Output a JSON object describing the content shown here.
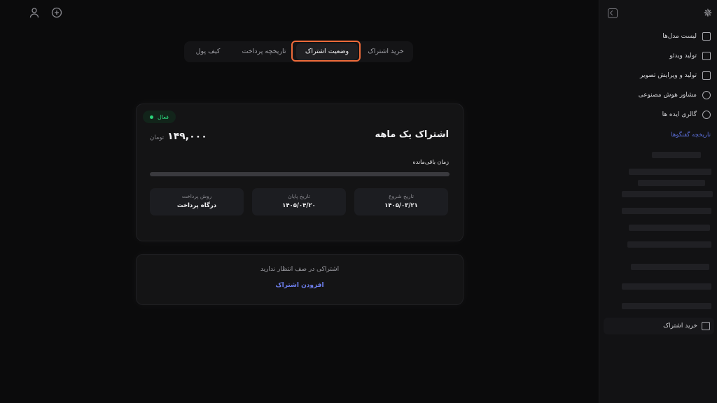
{
  "sidebar": {
    "items": [
      {
        "label": "لیست مدل‌ها",
        "icon": "model-list-icon"
      },
      {
        "label": "تولید ویدئو",
        "icon": "video-icon"
      },
      {
        "label": "تولید و ویرایش تصویر",
        "icon": "image-edit-icon"
      },
      {
        "label": "مشاور هوش مصنوعی",
        "icon": "robot-icon"
      },
      {
        "label": "گالری ایده ها",
        "icon": "gallery-icon"
      }
    ],
    "history_label": "تاریخچه گفتگوها",
    "buy_label": "خرید اشتراک"
  },
  "tabs": [
    {
      "label": "خرید اشتراک"
    },
    {
      "label": "وضعیت اشتراک",
      "active": true
    },
    {
      "label": "تاریخچه پرداخت"
    },
    {
      "label": "کیف پول"
    }
  ],
  "subscription": {
    "status": "فعال",
    "plan": "اشتراک یک ماهه",
    "price": "۱۴۹,۰۰۰",
    "currency": "تومان",
    "remaining_label": "زمان باقی‌مانده",
    "remaining_fraction": 0,
    "start_label": "تاریخ شروع",
    "start_value": "۱۴۰۵/۰۳/۲۱",
    "end_label": "تاریخ پایان",
    "end_value": "۱۴۰۵/۰۴/۲۰",
    "method_label": "روش پرداخت",
    "method_value": "درگاه پرداخت"
  },
  "queue": {
    "message": "اشتراکی در صف انتظار ندارید",
    "add_label": "افزودن اشتراک"
  },
  "colors": {
    "accent": "#6f80f0",
    "active_green": "#2bd47a",
    "highlight": "#ef6b3a"
  }
}
